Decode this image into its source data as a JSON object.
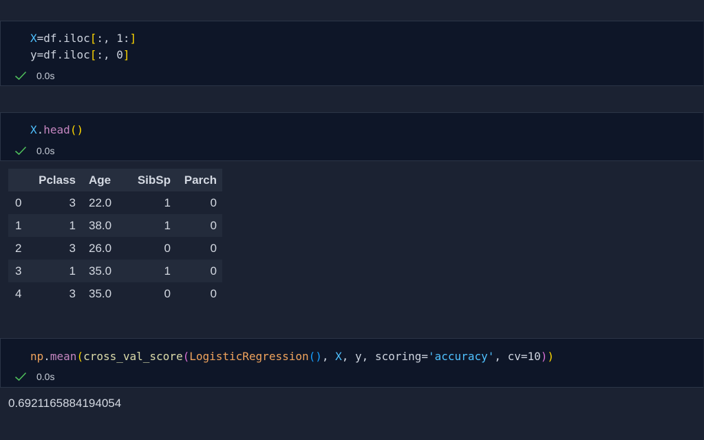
{
  "cells": [
    {
      "lines": [
        [
          {
            "text": "X",
            "cls": "t-var"
          },
          {
            "text": "=",
            "cls": "t-op"
          },
          {
            "text": "df.iloc",
            "cls": "t-op"
          },
          {
            "text": "[",
            "cls": "t-brk1"
          },
          {
            "text": ":, ",
            "cls": "t-op"
          },
          {
            "text": "1",
            "cls": "t-op"
          },
          {
            "text": ":",
            "cls": "t-op"
          },
          {
            "text": "]",
            "cls": "t-brk1"
          }
        ],
        [
          {
            "text": "y",
            "cls": "t-op"
          },
          {
            "text": "=",
            "cls": "t-op"
          },
          {
            "text": "df.iloc",
            "cls": "t-op"
          },
          {
            "text": "[",
            "cls": "t-brk1"
          },
          {
            "text": ":, ",
            "cls": "t-op"
          },
          {
            "text": "0",
            "cls": "t-op"
          },
          {
            "text": "]",
            "cls": "t-brk1"
          }
        ]
      ],
      "status": {
        "icon": "check-icon",
        "time": "0.0s"
      }
    },
    {
      "lines": [
        [
          {
            "text": "X",
            "cls": "t-var"
          },
          {
            "text": ".",
            "cls": "t-op"
          },
          {
            "text": "head",
            "cls": "t-attr"
          },
          {
            "text": "()",
            "cls": "t-brk1"
          }
        ]
      ],
      "status": {
        "icon": "check-icon",
        "time": "0.0s"
      }
    },
    {
      "lines": [
        [
          {
            "text": "np",
            "cls": "t-mod"
          },
          {
            "text": ".",
            "cls": "t-op"
          },
          {
            "text": "mean",
            "cls": "t-attr"
          },
          {
            "text": "(",
            "cls": "t-brk1"
          },
          {
            "text": "cross_val_score",
            "cls": "t-fn"
          },
          {
            "text": "(",
            "cls": "t-brk2"
          },
          {
            "text": "LogisticRegression",
            "cls": "t-mod"
          },
          {
            "text": "()",
            "cls": "t-brk3"
          },
          {
            "text": ", ",
            "cls": "t-op"
          },
          {
            "text": "X",
            "cls": "t-var"
          },
          {
            "text": ", y, scoring=",
            "cls": "t-op"
          },
          {
            "text": "'accuracy'",
            "cls": "t-var"
          },
          {
            "text": ", cv=10",
            "cls": "t-op"
          },
          {
            "text": ")",
            "cls": "t-brk2"
          },
          {
            "text": ")",
            "cls": "t-brk1"
          }
        ]
      ],
      "status": {
        "icon": "check-icon",
        "time": "0.0s"
      }
    }
  ],
  "dataframe": {
    "columns": [
      "Pclass",
      "Age",
      "SibSp",
      "Parch"
    ],
    "rows": [
      {
        "index": "0",
        "Pclass": "3",
        "Age": "22.0",
        "SibSp": "1",
        "Parch": "0"
      },
      {
        "index": "1",
        "Pclass": "1",
        "Age": "38.0",
        "SibSp": "1",
        "Parch": "0"
      },
      {
        "index": "2",
        "Pclass": "3",
        "Age": "26.0",
        "SibSp": "0",
        "Parch": "0"
      },
      {
        "index": "3",
        "Pclass": "1",
        "Age": "35.0",
        "SibSp": "1",
        "Parch": "0"
      },
      {
        "index": "4",
        "Pclass": "3",
        "Age": "35.0",
        "SibSp": "0",
        "Parch": "0"
      }
    ]
  },
  "output": {
    "value": "0.6921165884194054"
  },
  "colors": {
    "background": "#1b2232",
    "cell_background": "#0e1628",
    "success_check": "#4fbf5b"
  }
}
